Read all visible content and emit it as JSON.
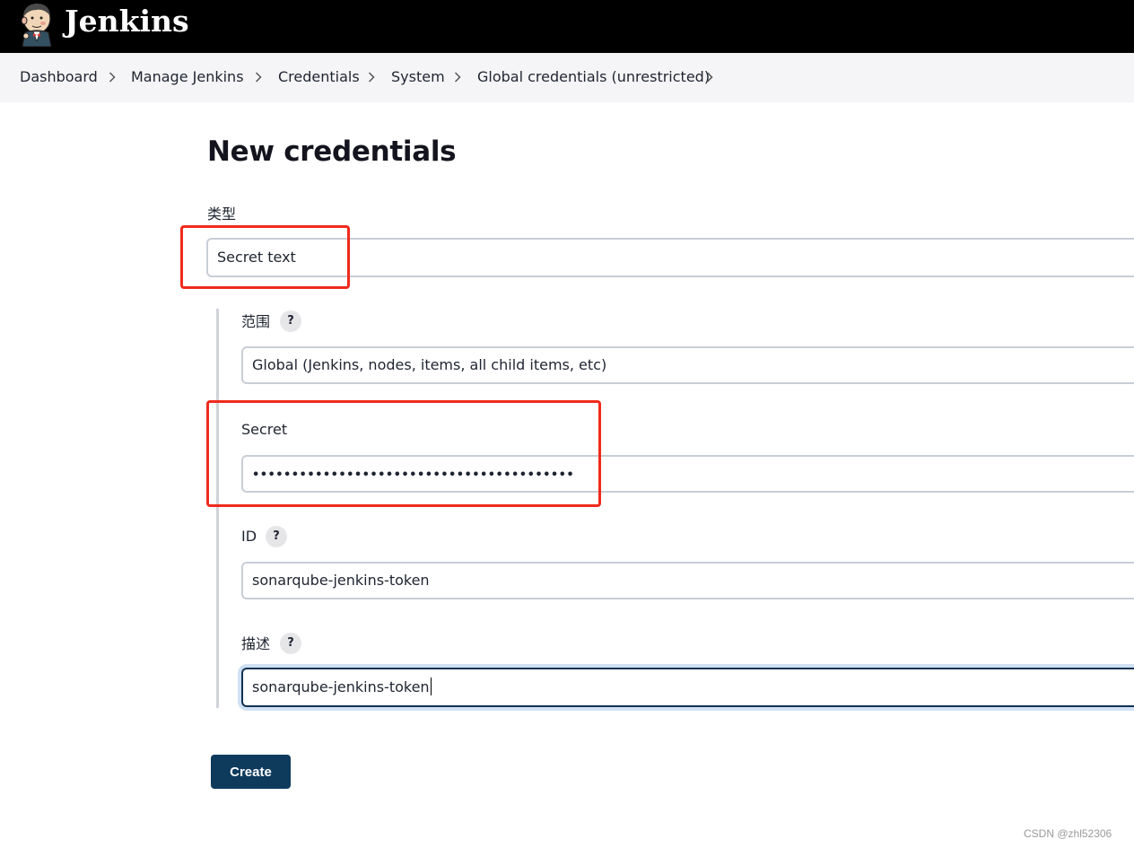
{
  "header": {
    "brand": "Jenkins",
    "logo_icon": "jenkins-butler-logo"
  },
  "breadcrumb": {
    "items": [
      "Dashboard",
      "Manage Jenkins",
      "Credentials",
      "System",
      "Global credentials (unrestricted)"
    ]
  },
  "page": {
    "title": "New credentials"
  },
  "form": {
    "kind_label": "类型",
    "kind_value": "Secret text",
    "scope_label": "范围",
    "scope_value": "Global (Jenkins, nodes, items, all child items, etc)",
    "secret_label": "Secret",
    "secret_masked": "•••••••••••••••••••••••••••••••••••••••••",
    "id_label": "ID",
    "id_value": "sonarqube-jenkins-token",
    "description_label": "描述",
    "description_value": "sonarqube-jenkins-token",
    "help_glyph": "?",
    "create_label": "Create"
  },
  "annotation": {
    "color": "#f02a1c"
  },
  "watermark": "CSDN @zhl52306",
  "colors": {
    "header_bg": "#000000",
    "breadcrumb_bg": "#f5f5f7",
    "button_bg": "#0e3a5c"
  }
}
